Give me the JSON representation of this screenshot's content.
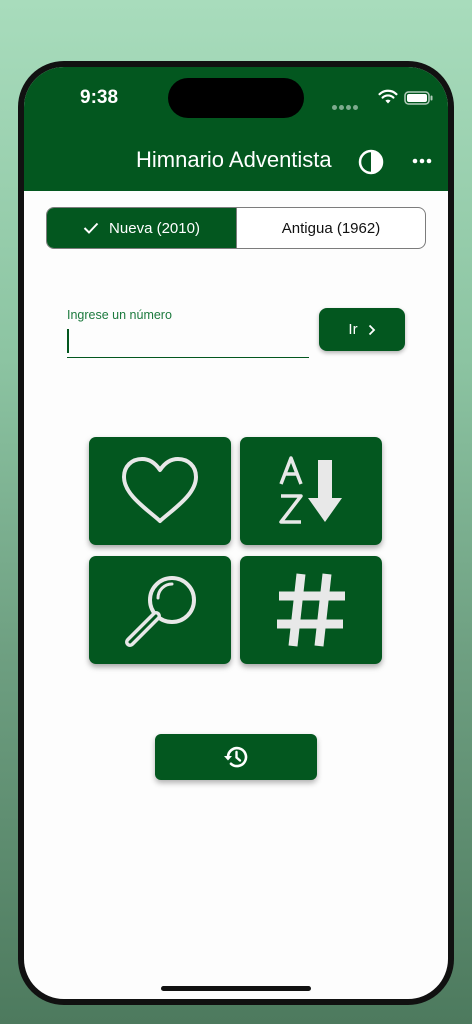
{
  "status_bar": {
    "time": "9:38"
  },
  "app_bar": {
    "title": "Himnario Adventista",
    "icons": [
      "theme-toggle-icon",
      "more-icon"
    ]
  },
  "segmented": {
    "options": [
      {
        "label": "Nueva (2010)",
        "selected": true
      },
      {
        "label": "Antigua (1962)",
        "selected": false
      }
    ]
  },
  "number_input": {
    "label": "Ingrese un número",
    "value": ""
  },
  "go_button": {
    "label": "Ir"
  },
  "tiles": [
    {
      "icon": "heart-icon"
    },
    {
      "icon": "sort-az-icon"
    },
    {
      "icon": "search-icon"
    },
    {
      "icon": "hash-icon"
    }
  ],
  "history_button": {
    "icon": "history-icon"
  },
  "colors": {
    "primary": "#03571f",
    "background": "#fdfdfd",
    "icon": "#e8e8e8"
  }
}
